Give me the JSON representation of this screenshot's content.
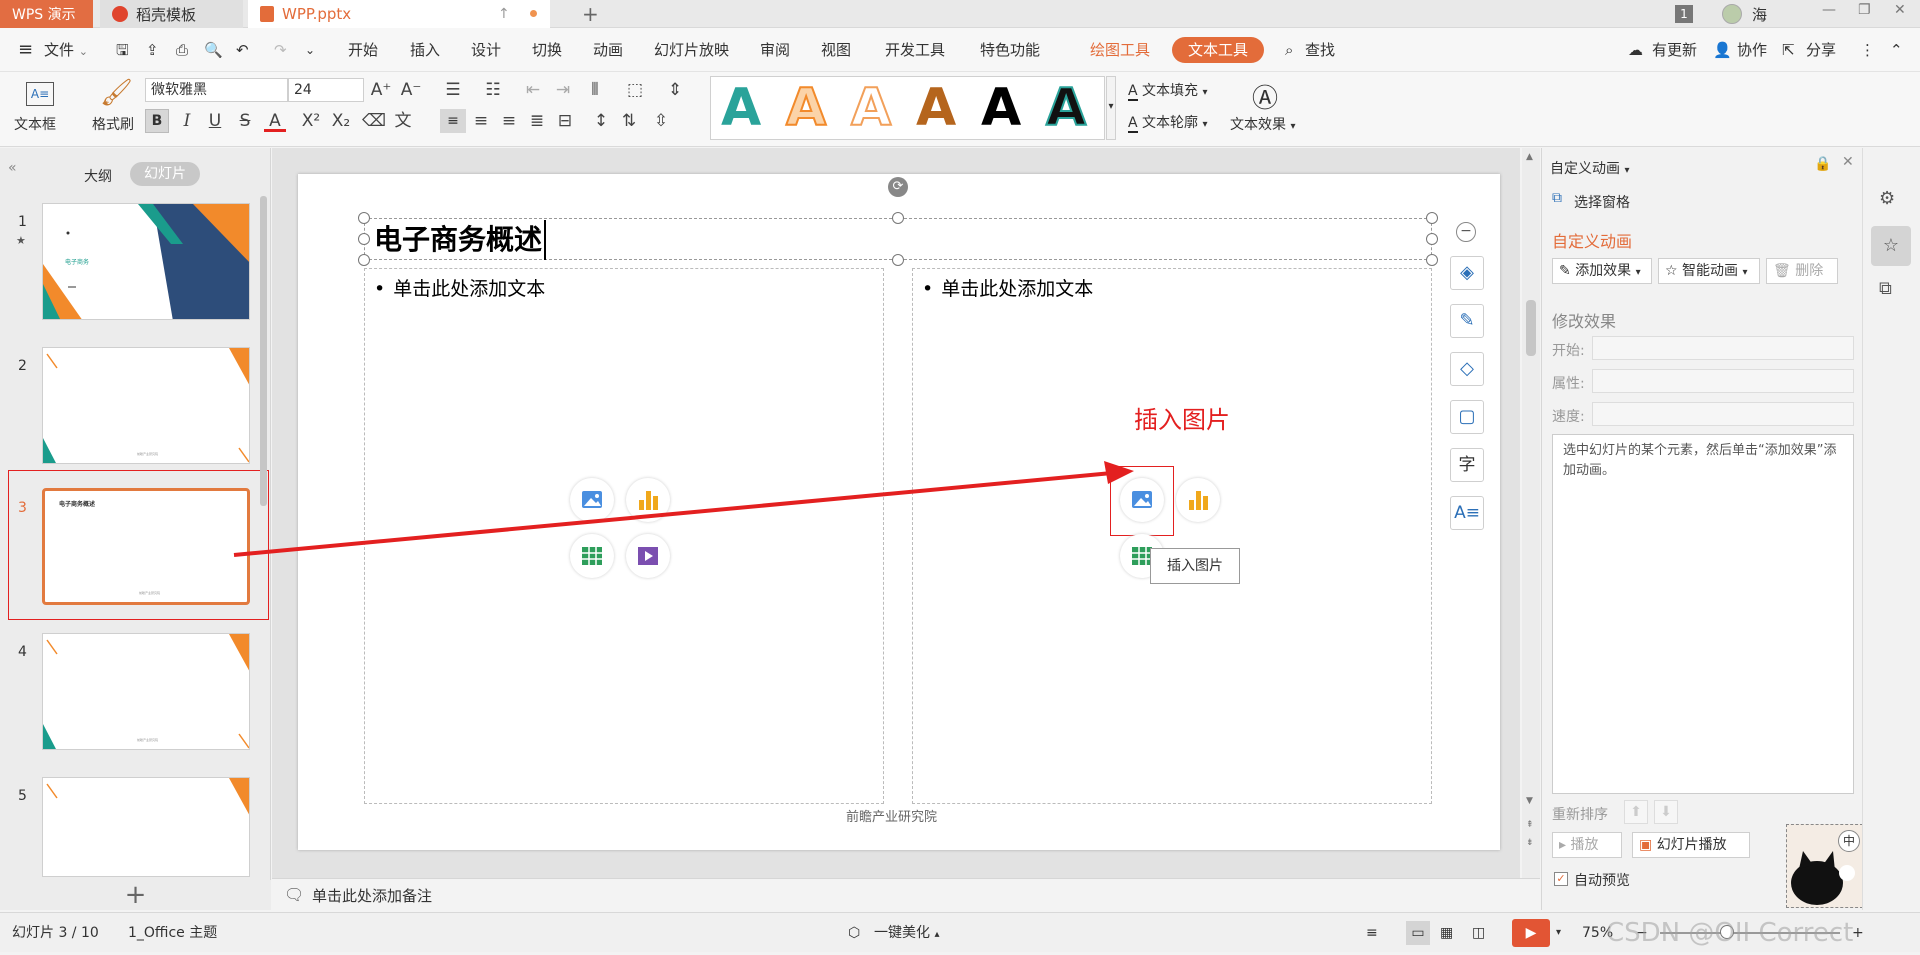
{
  "tabs": {
    "wps": "WPS 演示",
    "daoke": "稻壳模板",
    "file": "WPP.pptx",
    "new_tab": "+"
  },
  "window": {
    "badge": "1",
    "user": "海"
  },
  "menu": {
    "items": [
      "文件",
      "开始",
      "插入",
      "设计",
      "切换",
      "动画",
      "幻灯片放映",
      "审阅",
      "视图",
      "开发工具",
      "特色功能"
    ],
    "drawing_tools": "绘图工具",
    "text_tools": "文本工具",
    "search": "查找",
    "update": "有更新",
    "collab": "协作",
    "share": "分享"
  },
  "ribbon": {
    "textbox": "文本框",
    "format_painter": "格式刷",
    "font_name": "微软雅黑",
    "font_size": "24",
    "bold": "B",
    "italic": "I",
    "text_fill": "文本填充",
    "text_outline": "文本轮廓",
    "text_effect": "文本效果",
    "wordart_letter": "A"
  },
  "left": {
    "outline": "大纲",
    "slides": "幻灯片",
    "numbers": [
      "1",
      "2",
      "3",
      "4",
      "5"
    ],
    "add": "+"
  },
  "slide": {
    "title": "电子商务概述",
    "left_bullet": "单击此处添加文本",
    "right_bullet": "单击此处添加文本",
    "footer": "前瞻产业研究院",
    "annotation": "插入图片",
    "tooltip": "插入图片",
    "thumb1_text": "电子商务",
    "thumb3_title": "电子商务概述",
    "thumb_footer": "前瞻产业研究院"
  },
  "notes": {
    "placeholder": "单击此处添加备注"
  },
  "right_panel": {
    "header": "自定义动画",
    "selection_pane": "选择窗格",
    "section_title": "自定义动画",
    "add_effect": "添加效果",
    "smart_anim": "智能动画",
    "delete": "删除",
    "modify": "修改效果",
    "start": "开始:",
    "property": "属性:",
    "speed": "速度:",
    "hint": "选中幻灯片的某个元素，然后单击“添加效果”添加动画。",
    "reorder": "重新排序",
    "play": "播放",
    "slideshow": "幻灯片播放",
    "auto_preview": "自动预览",
    "ime": "中"
  },
  "status": {
    "slide_counter": "幻灯片 3 / 10",
    "theme": "1_Office 主题",
    "beautify": "一键美化",
    "zoom": "75%",
    "watermark": "CSDN @OII Correct"
  },
  "colors": {
    "accent": "#e36c3a",
    "orange": "#f28a2b",
    "teal": "#1a9c8c",
    "red_annotation": "#e32020",
    "wordart_teal": "#2aa39a"
  }
}
